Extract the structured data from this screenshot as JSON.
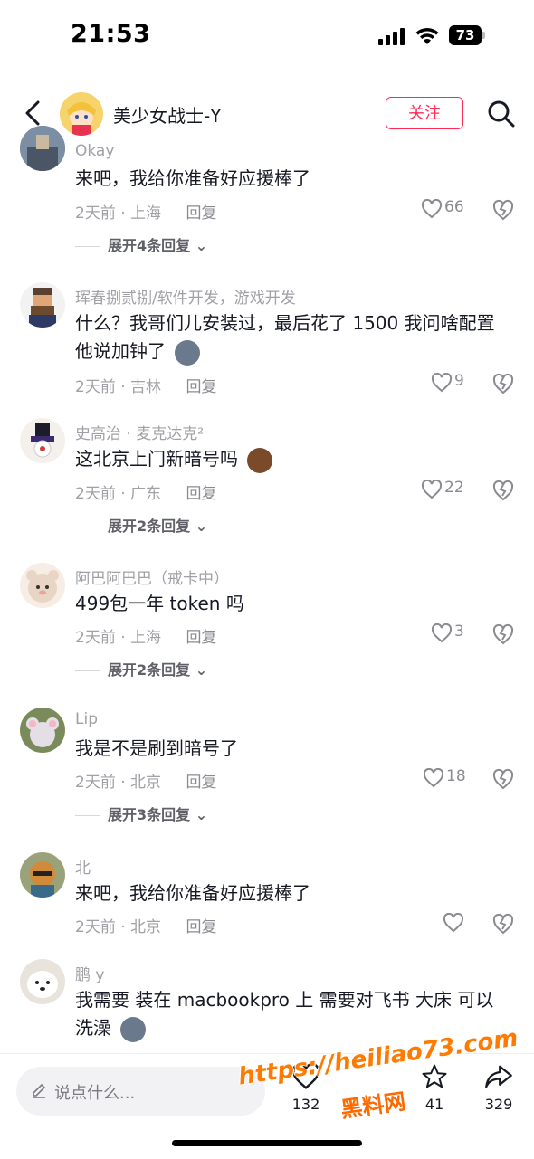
{
  "status_bar": {
    "time": "21:53",
    "battery": "73"
  },
  "header": {
    "title": "美少女战士-Y",
    "follow_label": "关注"
  },
  "comments": [
    {
      "user": "Okay",
      "text": "来吧，我给你准备好应援棒了",
      "meta": "2天前 · 上海",
      "reply": "回复",
      "likes": "66",
      "expand": "展开4条回复",
      "avatar_color": "#6b7d95"
    },
    {
      "user": "珲春捌贰捌/软件开发，游戏开发",
      "text": "什么？我哥们儿安装过，最后花了 1500  我问啥配置他说加钟了",
      "meta": "2天前 · 吉林",
      "reply": "回复",
      "likes": "9",
      "avatar_color": "#5a4030"
    },
    {
      "user": "史高治 · 麦克达克²",
      "text": "这北京上门新暗号吗",
      "meta": "2天前 · 广东",
      "reply": "回复",
      "likes": "22",
      "expand": "展开2条回复",
      "avatar_color": "#3b2a6e"
    },
    {
      "user": "阿巴阿巴巴（戒卡中）",
      "text": "499包一年 token 吗",
      "meta": "2天前 · 上海",
      "reply": "回复",
      "likes": "3",
      "expand": "展开2条回复",
      "avatar_color": "#e9d5c3"
    },
    {
      "user": "Lip",
      "text": "我是不是刷到暗号了",
      "meta": "2天前 · 北京",
      "reply": "回复",
      "likes": "18",
      "expand": "展开3条回复",
      "avatar_color": "#7a8a5a"
    },
    {
      "user": "北",
      "text": "来吧，我给你准备好应援棒了",
      "meta": "2天前 · 北京",
      "reply": "回复",
      "likes": "",
      "avatar_color": "#d08a3a"
    },
    {
      "user": "鹏 y",
      "text": "我需要 装在 macbookpro 上 需要对飞书 大床 可以洗澡",
      "meta": "",
      "reply": "",
      "likes": "",
      "avatar_color": "#e8e4dc"
    }
  ],
  "bottom_bar": {
    "input_placeholder": "说点什么...",
    "like_count": "132",
    "favorite_count": "41",
    "share_count": "329"
  },
  "watermark": {
    "url": "https://heiliao73.com",
    "brand": "黑料网"
  }
}
